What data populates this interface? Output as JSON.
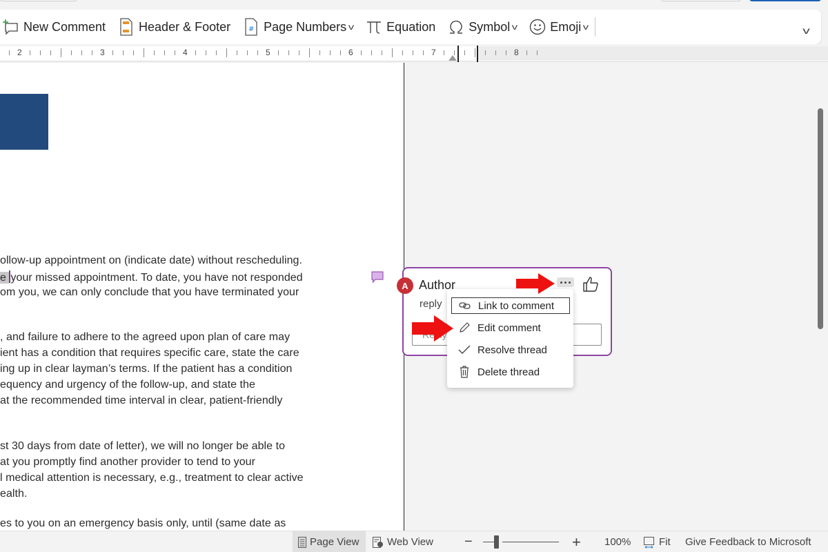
{
  "ribbon": {
    "items": [
      {
        "label": "New Comment",
        "icon": "new-comment-icon",
        "dropdown": false
      },
      {
        "label": "Header & Footer",
        "icon": "header-footer-icon",
        "dropdown": false
      },
      {
        "label": "Page Numbers",
        "icon": "page-numbers-icon",
        "dropdown": true
      },
      {
        "label": "Equation",
        "icon": "pi-icon",
        "dropdown": false
      },
      {
        "label": "Symbol",
        "icon": "omega-icon",
        "dropdown": true
      },
      {
        "label": "Emoji",
        "icon": "emoji-icon",
        "dropdown": true
      }
    ],
    "chevron": "⌄"
  },
  "ruler": {
    "numbers": [
      "2",
      "3",
      "4",
      "5",
      "6",
      "7",
      "8"
    ]
  },
  "document": {
    "lines": [
      {
        "text": "ollow-up appointment on (indicate date) without rescheduling."
      },
      {
        "pre_highlight": "",
        "highlight": "e ",
        "text": "your missed appointment. To date, you have not responded"
      },
      {
        "text": "om you, we can only conclude that you have terminated your"
      },
      {
        "text": ", and failure to adhere to the agreed upon plan of care may"
      },
      {
        "text": "ient has a condition that requires specific care, state the care"
      },
      {
        "text": "ing up in clear layman’s terms. If the patient has a condition"
      },
      {
        "text": "equency and urgency of the follow-up, and state the"
      },
      {
        "text": " at the recommended time interval in clear, patient-friendly"
      },
      {
        "text": "st 30 days from date of letter), we will no longer be able to"
      },
      {
        "text": "at you promptly find another provider to tend to your"
      },
      {
        "text": "l medical attention is necessary, e.g., treatment to clear active"
      },
      {
        "text": "ealth."
      },
      {
        "text": "es to you on an emergency basis only, until (same date as"
      }
    ]
  },
  "comment": {
    "avatar_initial": "A",
    "author": "Author",
    "body": "reply",
    "reply_placeholder": "Reply",
    "colors": {
      "border": "#8e44a3",
      "avatar": "#c62f36",
      "marker": "#d8b4e8"
    }
  },
  "context_menu": {
    "items": [
      {
        "label": "Link to comment",
        "icon": "link-icon",
        "focused": true
      },
      {
        "label": "Edit comment",
        "icon": "pencil-icon",
        "focused": false
      },
      {
        "label": "Resolve thread",
        "icon": "checkmark-icon",
        "focused": false
      },
      {
        "label": "Delete thread",
        "icon": "trash-icon",
        "focused": false
      }
    ]
  },
  "statusbar": {
    "page_view": "Page View",
    "web_view": "Web View",
    "zoom_minus": "−",
    "zoom_plus": "+",
    "zoom_level": "100%",
    "zoom_fraction": 0.2,
    "fit": "Fit",
    "feedback": "Give Feedback to Microsoft"
  },
  "annotations": {
    "arrow_color": "#ee1111"
  }
}
